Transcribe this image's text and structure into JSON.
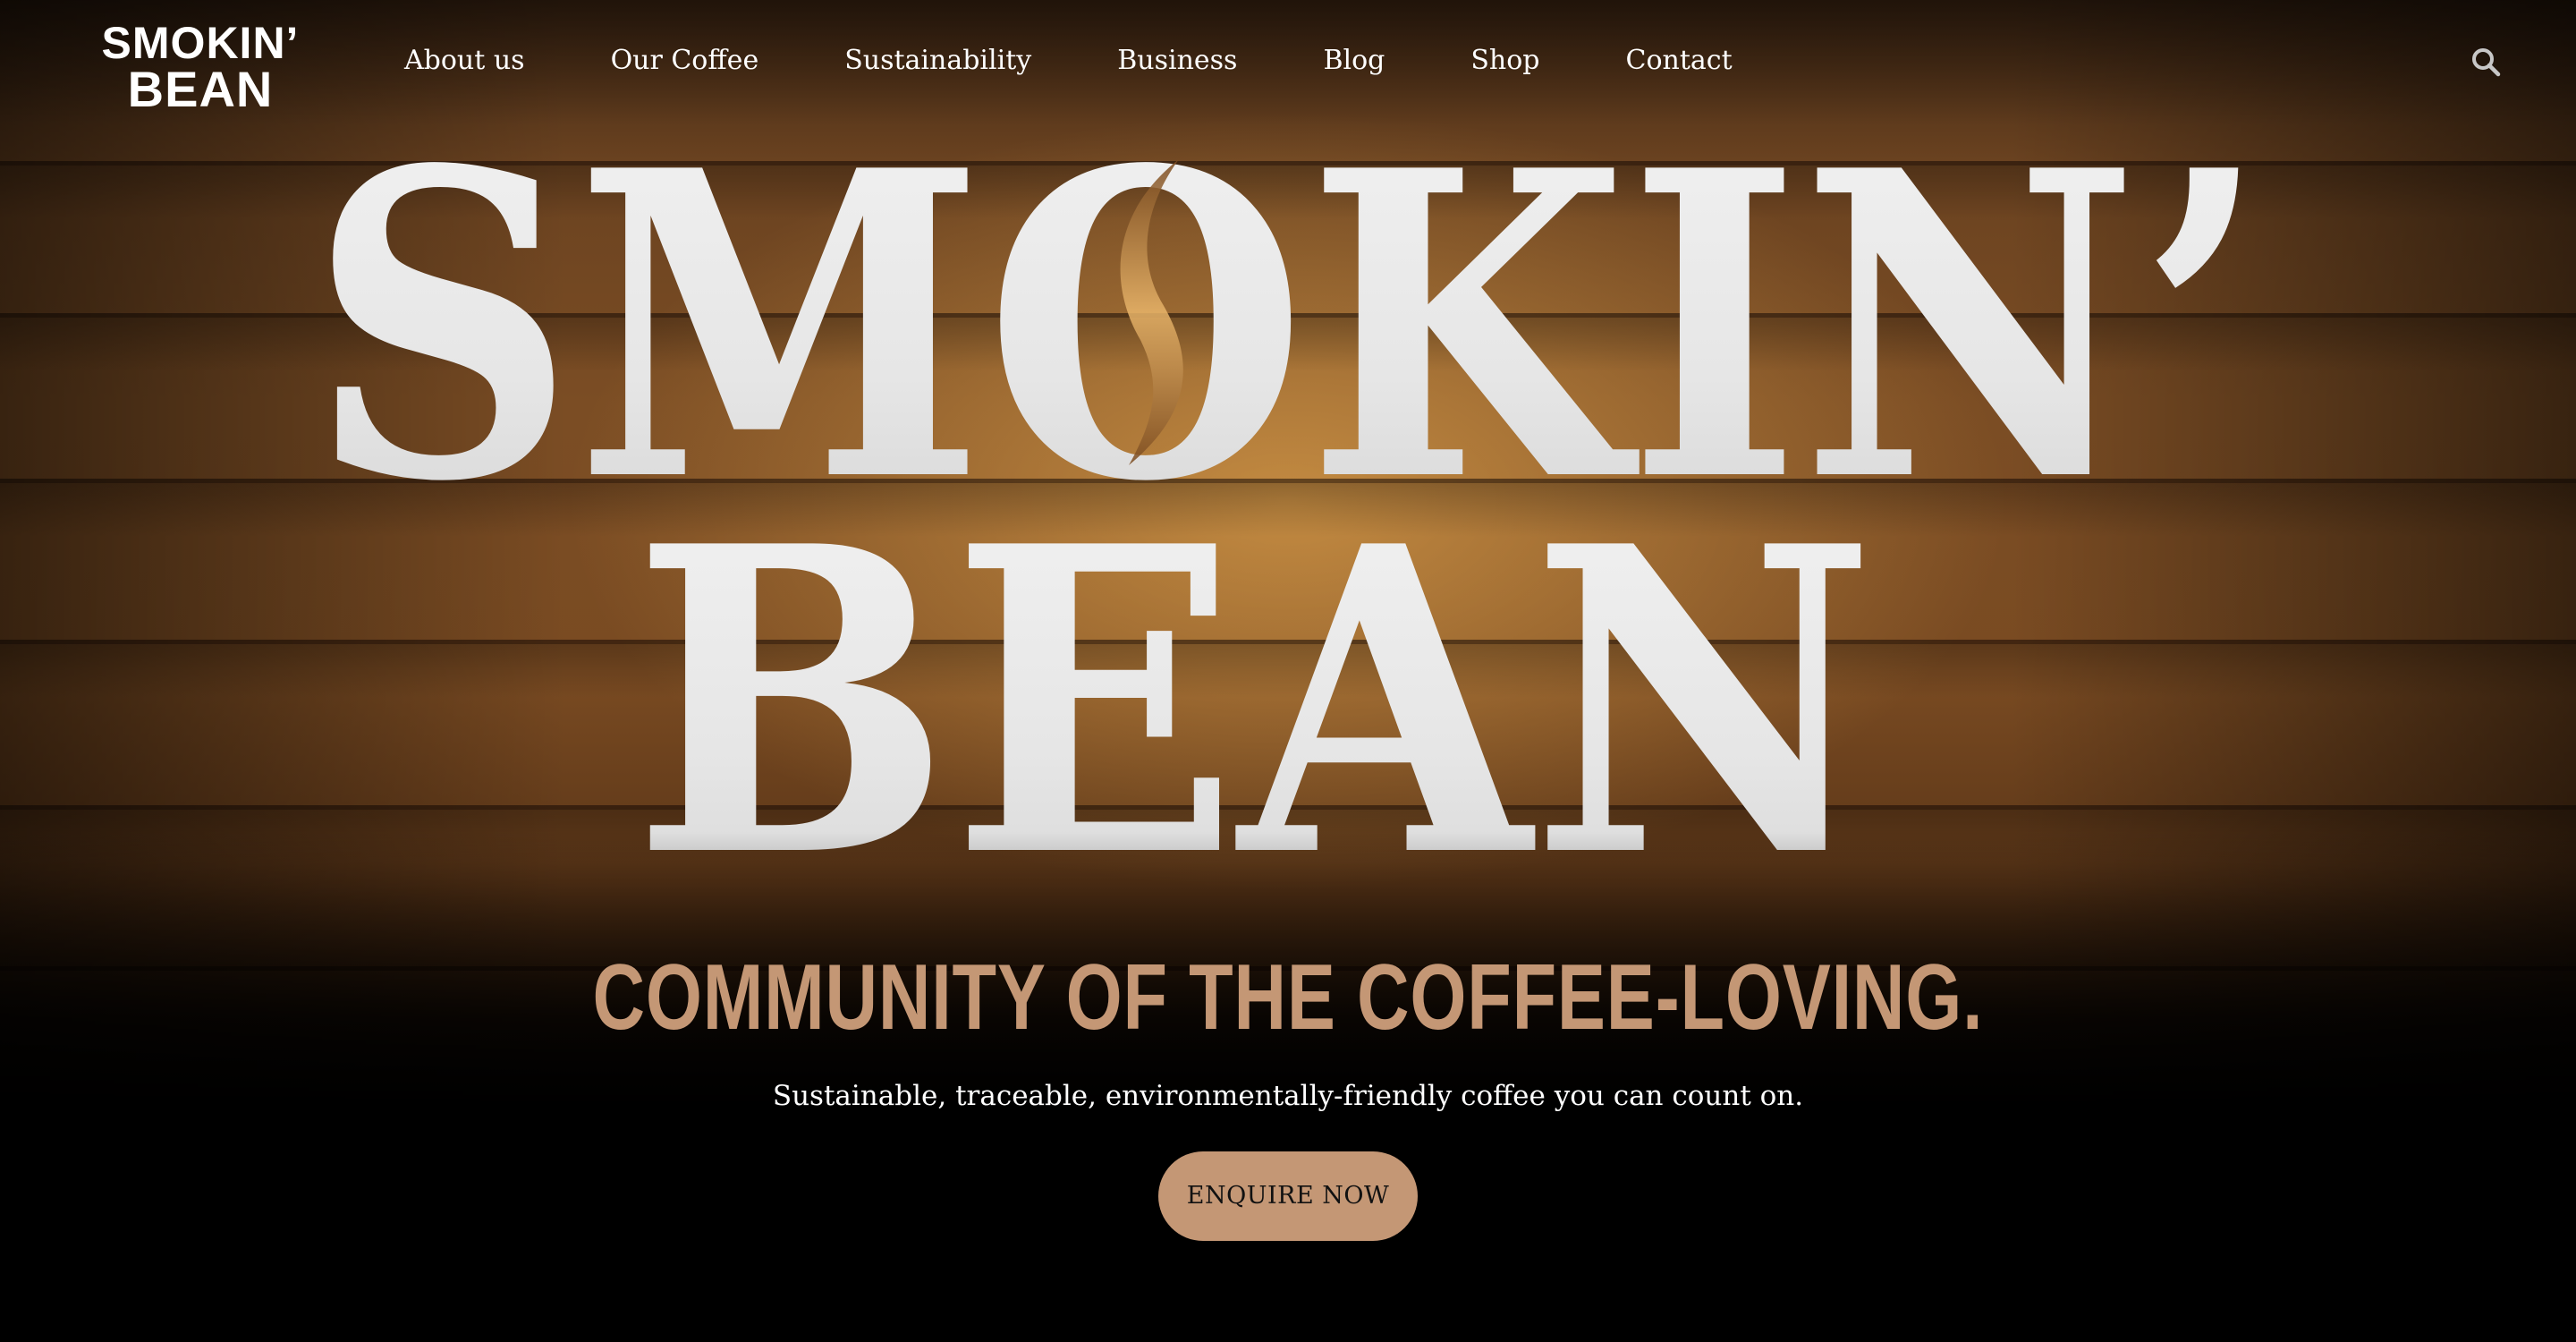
{
  "brand": {
    "logo_line1": "SMOKIN’",
    "logo_line2": "BEAN",
    "sign_line1": "SMOKIN’",
    "sign_line2": "BEAN",
    "accent_color": "#c49775"
  },
  "nav": {
    "items": [
      {
        "label": "About us"
      },
      {
        "label": "Our Coffee"
      },
      {
        "label": "Sustainability"
      },
      {
        "label": "Business"
      },
      {
        "label": "Blog"
      },
      {
        "label": "Shop"
      },
      {
        "label": "Contact"
      }
    ],
    "search_icon": "search-icon"
  },
  "hero": {
    "tagline": "COMMUNITY OF THE COFFEE-LOVING.",
    "subtitle": "Sustainable, traceable, environmentally-friendly coffee you can count on.",
    "cta_label": "ENQUIRE NOW"
  }
}
